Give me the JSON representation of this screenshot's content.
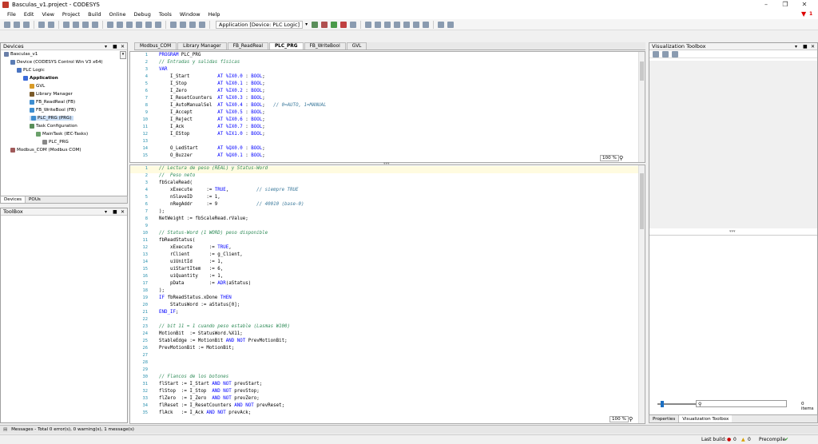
{
  "window": {
    "title": "Basculas_v1.project - CODESYS"
  },
  "menu": [
    "File",
    "Edit",
    "View",
    "Project",
    "Build",
    "Online",
    "Debug",
    "Tools",
    "Window",
    "Help"
  ],
  "toolbar": {
    "application_selector": "Application [Device: PLC Logic]"
  },
  "devices_panel": {
    "title": "Devices",
    "tree": [
      {
        "label": "Basculas_v1",
        "indent": 0,
        "icon": "project-icon",
        "color": "#6a7fa8"
      },
      {
        "label": "Device (CODESYS Control Win V3 x64)",
        "indent": 1,
        "icon": "device-icon",
        "color": "#5b7db5"
      },
      {
        "label": "PLC Logic",
        "indent": 2,
        "icon": "plc-logic-icon",
        "color": "#4a74c2"
      },
      {
        "label": "Application",
        "indent": 3,
        "icon": "application-icon",
        "color": "#3a6ad8",
        "bold": true
      },
      {
        "label": "GVL",
        "indent": 4,
        "icon": "gvl-icon",
        "color": "#d89b28"
      },
      {
        "label": "Library Manager",
        "indent": 4,
        "icon": "library-icon",
        "color": "#7a5a2a"
      },
      {
        "label": "FB_ReadReal (FB)",
        "indent": 4,
        "icon": "fb-icon",
        "color": "#3e8ed0"
      },
      {
        "label": "FB_WriteBool (FB)",
        "indent": 4,
        "icon": "fb-icon",
        "color": "#3e8ed0"
      },
      {
        "label": "PLC_PRG (PRG)",
        "indent": 4,
        "icon": "prg-icon",
        "color": "#3e8ed0",
        "selected": true
      },
      {
        "label": "Task Configuration",
        "indent": 4,
        "icon": "task-config-icon",
        "color": "#5a8e5a"
      },
      {
        "label": "MainTask (IEC-Tasks)",
        "indent": 5,
        "icon": "task-icon",
        "color": "#6aa06a"
      },
      {
        "label": "PLC_PRG",
        "indent": 6,
        "icon": "prg-call-icon",
        "color": "#888888"
      },
      {
        "label": "Modbus_COM (Modbus COM)",
        "indent": 1,
        "icon": "modbus-icon",
        "color": "#a05a5a"
      }
    ],
    "bottom_tabs": [
      "Devices",
      "POUs"
    ]
  },
  "toolbox_panel": {
    "title": "ToolBox"
  },
  "editor_tabs": [
    {
      "label": "Modbus_COM",
      "active": false
    },
    {
      "label": "Library Manager",
      "active": false
    },
    {
      "label": "FB_ReadReal",
      "active": false
    },
    {
      "label": "PLC_PRG",
      "active": true
    },
    {
      "label": "FB_WriteBool",
      "active": false
    },
    {
      "label": "GVL",
      "active": false
    }
  ],
  "decl_code": [
    {
      "n": "1",
      "text": "PROGRAM PLC_PRG",
      "type": "kw"
    },
    {
      "n": "2",
      "text": "// Entradas y salidas físicas",
      "type": "cm"
    },
    {
      "n": "3",
      "text": "VAR",
      "type": "kw"
    },
    {
      "n": "4",
      "text": "    I_Start          AT %IX0.0 : BOOL;",
      "type": "decl"
    },
    {
      "n": "5",
      "text": "    I_Stop           AT %IX0.1 : BOOL;",
      "type": "decl"
    },
    {
      "n": "6",
      "text": "    I_Zero           AT %IX0.2 : BOOL;",
      "type": "decl"
    },
    {
      "n": "7",
      "text": "    I_ResetCounters  AT %IX0.3 : BOOL;",
      "type": "decl"
    },
    {
      "n": "8",
      "text": "    I_AutoManualSel  AT %IX0.4 : BOOL;   // 0=AUTO, 1=MANUAL",
      "type": "decl"
    },
    {
      "n": "9",
      "text": "    I_Accept         AT %IX0.5 : BOOL;",
      "type": "decl"
    },
    {
      "n": "10",
      "text": "    I_Reject         AT %IX0.6 : BOOL;",
      "type": "decl"
    },
    {
      "n": "11",
      "text": "    I_Ack            AT %IX0.7 : BOOL;",
      "type": "decl"
    },
    {
      "n": "12",
      "text": "    I_EStop          AT %IX1.0 : BOOL;",
      "type": "decl"
    },
    {
      "n": "13",
      "text": "",
      "type": "plain"
    },
    {
      "n": "14",
      "text": "    O_LedStart       AT %QX0.0 : BOOL;",
      "type": "decl"
    },
    {
      "n": "15",
      "text": "    O_Buzzer         AT %QX0.1 : BOOL;",
      "type": "decl"
    }
  ],
  "impl_code": [
    {
      "n": "1",
      "text": "// Lectura de peso (REAL) y Status-Word",
      "type": "cm"
    },
    {
      "n": "2",
      "text": "//  Peso neto",
      "type": "cm"
    },
    {
      "n": "3",
      "text": "fbScaleRead(",
      "type": "plain"
    },
    {
      "n": "4",
      "text": "    xExecute     := TRUE,          // siempre TRUE",
      "type": "mix"
    },
    {
      "n": "5",
      "text": "    nSlaveID     := 1,",
      "type": "plain"
    },
    {
      "n": "6",
      "text": "    nRegAddr     := 9              // 40010 (base-0)",
      "type": "mix"
    },
    {
      "n": "7",
      "text": ");",
      "type": "plain"
    },
    {
      "n": "8",
      "text": "NetWeight := fbScaleRead.rValue;",
      "type": "plain"
    },
    {
      "n": "9",
      "text": "",
      "type": "plain"
    },
    {
      "n": "10",
      "text": "// Status-Word (1 WORD) peso disponible",
      "type": "cm"
    },
    {
      "n": "11",
      "text": "fbReadStatus(",
      "type": "plain"
    },
    {
      "n": "12",
      "text": "    xExecute      := TRUE,",
      "type": "plain"
    },
    {
      "n": "13",
      "text": "    rClient       := g_Client,",
      "type": "plain"
    },
    {
      "n": "14",
      "text": "    uiUnitId      := 1,",
      "type": "plain"
    },
    {
      "n": "15",
      "text": "    uiStartItem   := 6,",
      "type": "plain"
    },
    {
      "n": "16",
      "text": "    uiQuantity    := 1,",
      "type": "plain"
    },
    {
      "n": "17",
      "text": "    pData         := ADR(aStatus)",
      "type": "plain"
    },
    {
      "n": "18",
      "text": ");",
      "type": "plain"
    },
    {
      "n": "19",
      "text": "IF fbReadStatus.xDone THEN",
      "type": "plain"
    },
    {
      "n": "20",
      "text": "    StatusWord := aStatus[0];",
      "type": "plain"
    },
    {
      "n": "21",
      "text": "END_IF;",
      "type": "kw"
    },
    {
      "n": "22",
      "text": "",
      "type": "plain"
    },
    {
      "n": "23",
      "text": "// bit 11 = 1 cuando peso estable (Lasmas W100)",
      "type": "cm"
    },
    {
      "n": "24",
      "text": "MotionBit  := StatusWord.%X11;",
      "type": "plain"
    },
    {
      "n": "25",
      "text": "StableEdge := MotionBit AND NOT PrevMotionBit;",
      "type": "plain"
    },
    {
      "n": "26",
      "text": "PrevMotionBit := MotionBit;",
      "type": "plain"
    },
    {
      "n": "27",
      "text": "",
      "type": "plain"
    },
    {
      "n": "28",
      "text": "",
      "type": "plain"
    },
    {
      "n": "29",
      "text": "",
      "type": "plain"
    },
    {
      "n": "30",
      "text": "// Flancos de los botones",
      "type": "cm"
    },
    {
      "n": "31",
      "text": "flStart := I_Start AND NOT prevStart;",
      "type": "plain"
    },
    {
      "n": "32",
      "text": "flStop  := I_Stop  AND NOT prevStop;",
      "type": "plain"
    },
    {
      "n": "33",
      "text": "flZero  := I_Zero  AND NOT prevZero;",
      "type": "plain"
    },
    {
      "n": "34",
      "text": "flReset := I_ResetCounters AND NOT prevReset;",
      "type": "plain"
    },
    {
      "n": "35",
      "text": "flAck   := I_Ack AND NOT prevAck;",
      "type": "plain"
    }
  ],
  "zoom": {
    "decl": "100 %",
    "impl": "100 %"
  },
  "viz_panel": {
    "title": "Visualization Toolbox",
    "items_count": "0 items",
    "bottom_tabs": [
      "Properties",
      "Visualization Toolbox"
    ]
  },
  "messages": {
    "text": "Messages - Total 0 error(s), 0 warning(s), 1 message(s)"
  },
  "status": {
    "last_build_label": "Last build:",
    "errors": "0",
    "warnings": "0",
    "precompile": "Precompile"
  },
  "notification": {
    "count": "1"
  }
}
